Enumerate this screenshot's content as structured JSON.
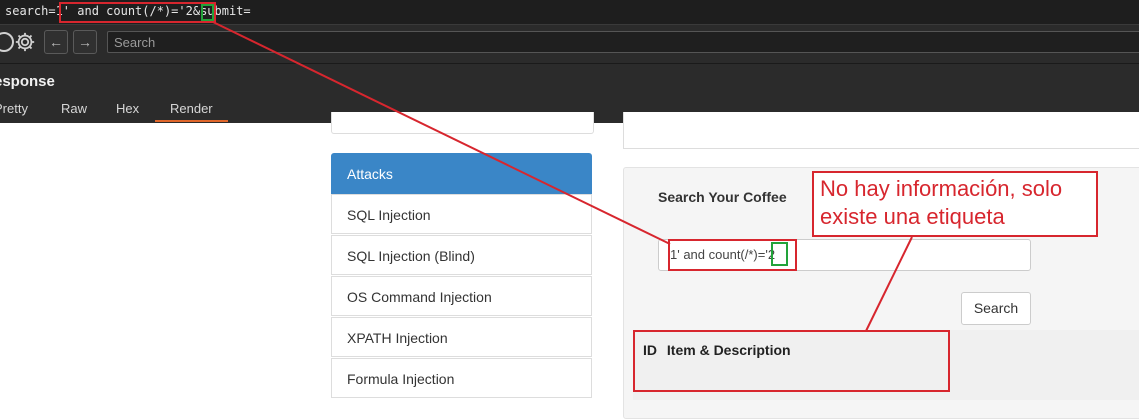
{
  "request": {
    "prefix": "search=",
    "payload": "1' and count(/*)='",
    "digit": "2",
    "suffix": "&submit="
  },
  "toolbar": {
    "search_placeholder": "Search",
    "icons": [
      "circle-icon",
      "gear-icon",
      "arrow-left-icon",
      "arrow-right-icon"
    ]
  },
  "response": {
    "title": "esponse",
    "tabs": [
      "Pretty",
      "Raw",
      "Hex",
      "Render"
    ],
    "active_tab": "Render"
  },
  "sidebar": {
    "header": "Attacks",
    "items": [
      "SQL Injection",
      "SQL Injection (Blind)",
      "OS Command Injection",
      "XPATH Injection",
      "Formula Injection"
    ]
  },
  "main": {
    "title": "Search Your Coffee",
    "input_payload": "1' and count(/*)='",
    "input_digit": "2",
    "search_button": "Search",
    "columns": [
      "ID",
      "Item & Description"
    ]
  },
  "annotation": {
    "line1": "No hay información, solo",
    "line2": "existe una etiqueta"
  },
  "colors": {
    "annotation_red": "#d7262e",
    "highlight_green": "#22a33a",
    "sidebar_header": "#3a86c7",
    "active_tab_underline": "#e0662a"
  }
}
